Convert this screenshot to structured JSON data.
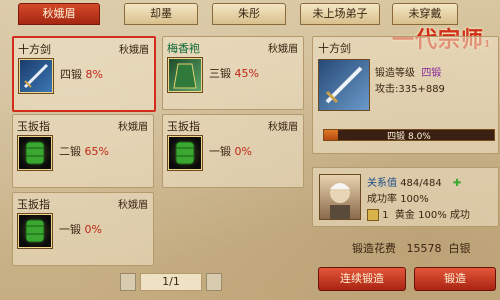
{
  "tabs": [
    {
      "label": "秋娥眉",
      "active": true
    },
    {
      "label": "却墨",
      "active": false
    },
    {
      "label": "朱彤",
      "active": false
    },
    {
      "label": "未上场弟子",
      "active": false
    },
    {
      "label": "未穿戴",
      "active": false
    }
  ],
  "items": [
    {
      "name": "十方剑",
      "owner": "秋娥眉",
      "forge": "四锻",
      "pct": "8%",
      "icon": "sword-icon",
      "selected": true
    },
    {
      "name": "梅香袍",
      "owner": "秋娥眉",
      "forge": "三锻",
      "pct": "45%",
      "icon": "robe-icon",
      "selected": false
    },
    {
      "name": "玉扳指",
      "owner": "秋娥眉",
      "forge": "二锻",
      "pct": "65%",
      "icon": "jade-ring-icon",
      "selected": false
    },
    {
      "name": "玉扳指",
      "owner": "秋娥眉",
      "forge": "一锻",
      "pct": "0%",
      "icon": "jade-ring-icon",
      "selected": false
    },
    {
      "name": "玉扳指",
      "owner": "秋娥眉",
      "forge": "一锻",
      "pct": "0%",
      "icon": "jade-ring-icon",
      "selected": false
    }
  ],
  "detail": {
    "name": "十方剑",
    "level_label": "锻造等级",
    "level_value": "四锻",
    "attack": "攻击:335+889",
    "progress_text": "四锻  8.0%",
    "progress": 0.08
  },
  "npc": {
    "relation_label": "关系值",
    "relation_value": "484/484",
    "rate_label": "成功率",
    "rate_value": "100%",
    "count": "1",
    "gold_label": "黄金",
    "gold_rate": "100%",
    "gold_suffix": "成功"
  },
  "cost": {
    "label": "锻造花费",
    "value": "15578",
    "unit": "白银"
  },
  "pager": {
    "label": "1/1"
  },
  "buttons": {
    "continuous": "连续锻造",
    "forge": "锻造"
  },
  "logo": {
    "text": "一代宗师",
    "sub": "1"
  },
  "colors": {
    "accent": "#d32c1c",
    "tab_active": "#b8301a",
    "progress": "#d2691e"
  }
}
